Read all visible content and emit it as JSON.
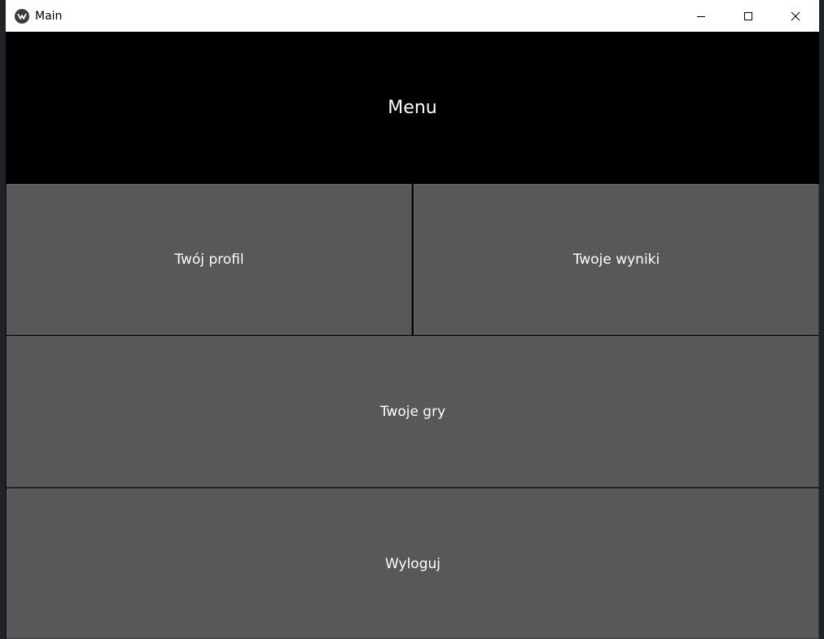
{
  "window": {
    "title": "Main",
    "app_icon": "kivy-logo-icon",
    "controls": {
      "minimize": "minimize-icon",
      "maximize": "maximize-icon",
      "close": "close-icon"
    }
  },
  "header": {
    "title": "Menu"
  },
  "menu": {
    "profile_label": "Twój profil",
    "results_label": "Twoje wyniki",
    "games_label": "Twoje gry",
    "logout_label": "Wyloguj"
  },
  "colors": {
    "header_bg": "#000000",
    "button_bg": "#585858",
    "button_text": "#ffffff",
    "titlebar_bg": "#ffffff"
  }
}
